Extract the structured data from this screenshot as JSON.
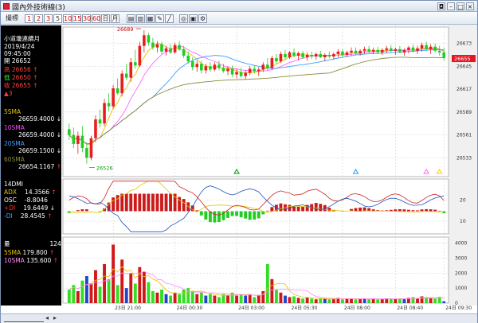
{
  "window": {
    "title": "國內外技術線(3)"
  },
  "toolbar": {
    "item_label": "撮標",
    "period_buttons": [
      "1",
      "2",
      "3",
      "5",
      "10",
      "15",
      "30",
      "60",
      "日",
      "月"
    ],
    "icon_names": [
      "layout-icon",
      "bar-style-icon",
      "grid-icon",
      "draw-icon",
      "line-icon",
      "find-icon",
      "chart-icon",
      "settings-icon"
    ]
  },
  "info": {
    "name": "小道瓊連續月",
    "date": "2019/4/24",
    "time": "09:45:00",
    "open_label": "開",
    "open_value": "26652",
    "high_label": "高",
    "high_value": "26656",
    "low_label": "低",
    "low_value": "26650",
    "close_label": "收",
    "close_value": "26655",
    "change": "▲3",
    "ma": [
      {
        "label": "5SMA",
        "value": "26659.4000",
        "arrow": "↓",
        "color": "#e6c300"
      },
      {
        "label": "10SMA",
        "value": "26659.4000",
        "arrow": "↓",
        "color": "#ff44ff"
      },
      {
        "label": "20SMA",
        "value": "26659.1500",
        "arrow": "↓",
        "color": "#3f9fff"
      },
      {
        "label": "60SMA",
        "value": "26654.1167",
        "arrow": "↑",
        "color": "#8a8a3a"
      }
    ],
    "dmi_title": "14DMI",
    "dmi": [
      {
        "label": "ADX",
        "value": "14.3566",
        "arrow": "↑",
        "color": "#e6c300"
      },
      {
        "label": "OSC",
        "value": "-8.8046",
        "arrow": "",
        "color": "#ffffff"
      },
      {
        "label": "+DI",
        "value": "19.6449",
        "arrow": "↓",
        "color": "#ff3030"
      },
      {
        "label": "-DI",
        "value": "28.4545",
        "arrow": "↑",
        "color": "#3f9fff"
      }
    ],
    "vol_title": "量",
    "vol_value": "124",
    "vol_ma": [
      {
        "label": "5SMA",
        "value": "179.800",
        "arrow": "↑",
        "color": "#e6c300"
      },
      {
        "label": "10SMA",
        "value": "135.600",
        "arrow": "↑",
        "color": "#ff88ff"
      }
    ]
  },
  "chart_data": {
    "type": "candlestick",
    "price_axis": {
      "ticks": [
        "26673",
        "26645",
        "26617",
        "26589",
        "26561",
        "26533"
      ],
      "range": [
        26510,
        26693
      ]
    },
    "last_price": "26655",
    "annotations": {
      "high": "26689",
      "low": "26526"
    },
    "dmi_axis": {
      "ticks": [
        "20",
        "10"
      ]
    },
    "volume_axis": {
      "ticks": [
        "4000",
        "3000",
        "2000",
        "1000",
        "0"
      ],
      "range": [
        0,
        4400
      ]
    },
    "time_labels": [
      "23日 21:00",
      "24日 00:30",
      "24日 03:00",
      "24日 05:30",
      "24日 08:00",
      "24日 08:40",
      "24日 09:30"
    ],
    "bars": [
      {
        "o": 26568,
        "h": 26575,
        "l": 26555,
        "c": 26561,
        "v": 900
      },
      {
        "o": 26561,
        "h": 26570,
        "l": 26545,
        "c": 26550,
        "v": 1200
      },
      {
        "o": 26550,
        "h": 26565,
        "l": 26538,
        "c": 26560,
        "v": 800
      },
      {
        "o": 26560,
        "h": 26572,
        "l": 26540,
        "c": 26545,
        "v": 1500
      },
      {
        "o": 26545,
        "h": 26552,
        "l": 26526,
        "c": 26533,
        "v": 1800
      },
      {
        "o": 26533,
        "h": 26560,
        "l": 26530,
        "c": 26557,
        "v": 1300
      },
      {
        "o": 26557,
        "h": 26585,
        "l": 26552,
        "c": 26580,
        "v": 2200
      },
      {
        "o": 26580,
        "h": 26592,
        "l": 26570,
        "c": 26575,
        "v": 1100
      },
      {
        "o": 26575,
        "h": 26605,
        "l": 26572,
        "c": 26600,
        "v": 2600
      },
      {
        "o": 26600,
        "h": 26612,
        "l": 26590,
        "c": 26596,
        "v": 1600
      },
      {
        "o": 26596,
        "h": 26622,
        "l": 26593,
        "c": 26618,
        "v": 3900
      },
      {
        "o": 26618,
        "h": 26630,
        "l": 26610,
        "c": 26612,
        "v": 1200
      },
      {
        "o": 26612,
        "h": 26640,
        "l": 26608,
        "c": 26636,
        "v": 2900
      },
      {
        "o": 26636,
        "h": 26648,
        "l": 26628,
        "c": 26631,
        "v": 1000
      },
      {
        "o": 26631,
        "h": 26655,
        "l": 26626,
        "c": 26650,
        "v": 2000
      },
      {
        "o": 26650,
        "h": 26665,
        "l": 26642,
        "c": 26646,
        "v": 1300
      },
      {
        "o": 26646,
        "h": 26675,
        "l": 26644,
        "c": 26670,
        "v": 2400
      },
      {
        "o": 26670,
        "h": 26689,
        "l": 26662,
        "c": 26683,
        "v": 2100
      },
      {
        "o": 26683,
        "h": 26686,
        "l": 26670,
        "c": 26674,
        "v": 1400
      },
      {
        "o": 26674,
        "h": 26680,
        "l": 26665,
        "c": 26668,
        "v": 800
      },
      {
        "o": 26668,
        "h": 26676,
        "l": 26662,
        "c": 26672,
        "v": 700
      },
      {
        "o": 26672,
        "h": 26675,
        "l": 26660,
        "c": 26663,
        "v": 900
      },
      {
        "o": 26663,
        "h": 26670,
        "l": 26658,
        "c": 26667,
        "v": 600
      },
      {
        "o": 26667,
        "h": 26672,
        "l": 26660,
        "c": 26662,
        "v": 500
      },
      {
        "o": 26662,
        "h": 26674,
        "l": 26660,
        "c": 26671,
        "v": 700
      },
      {
        "o": 26671,
        "h": 26676,
        "l": 26664,
        "c": 26666,
        "v": 600
      },
      {
        "o": 26666,
        "h": 26670,
        "l": 26655,
        "c": 26658,
        "v": 900
      },
      {
        "o": 26658,
        "h": 26663,
        "l": 26648,
        "c": 26651,
        "v": 1000
      },
      {
        "o": 26651,
        "h": 26656,
        "l": 26640,
        "c": 26644,
        "v": 800
      },
      {
        "o": 26644,
        "h": 26652,
        "l": 26638,
        "c": 26648,
        "v": 600
      },
      {
        "o": 26648,
        "h": 26652,
        "l": 26636,
        "c": 26640,
        "v": 700
      },
      {
        "o": 26640,
        "h": 26648,
        "l": 26636,
        "c": 26645,
        "v": 500
      },
      {
        "o": 26645,
        "h": 26650,
        "l": 26638,
        "c": 26641,
        "v": 600
      },
      {
        "o": 26641,
        "h": 26650,
        "l": 26639,
        "c": 26647,
        "v": 500
      },
      {
        "o": 26647,
        "h": 26652,
        "l": 26640,
        "c": 26643,
        "v": 400
      },
      {
        "o": 26643,
        "h": 26648,
        "l": 26637,
        "c": 26639,
        "v": 600
      },
      {
        "o": 26639,
        "h": 26645,
        "l": 26634,
        "c": 26642,
        "v": 500
      },
      {
        "o": 26642,
        "h": 26646,
        "l": 26632,
        "c": 26635,
        "v": 700
      },
      {
        "o": 26635,
        "h": 26642,
        "l": 26630,
        "c": 26638,
        "v": 500
      },
      {
        "o": 26638,
        "h": 26643,
        "l": 26631,
        "c": 26633,
        "v": 600
      },
      {
        "o": 26633,
        "h": 26640,
        "l": 26629,
        "c": 26637,
        "v": 500
      },
      {
        "o": 26637,
        "h": 26645,
        "l": 26634,
        "c": 26642,
        "v": 600
      },
      {
        "o": 26642,
        "h": 26646,
        "l": 26636,
        "c": 26639,
        "v": 400
      },
      {
        "o": 26639,
        "h": 26644,
        "l": 26633,
        "c": 26641,
        "v": 500
      },
      {
        "o": 26641,
        "h": 26650,
        "l": 26638,
        "c": 26647,
        "v": 800
      },
      {
        "o": 26647,
        "h": 26655,
        "l": 26640,
        "c": 26643,
        "v": 2600
      },
      {
        "o": 26643,
        "h": 26658,
        "l": 26641,
        "c": 26655,
        "v": 1600
      },
      {
        "o": 26655,
        "h": 26660,
        "l": 26648,
        "c": 26651,
        "v": 900
      },
      {
        "o": 26651,
        "h": 26663,
        "l": 26649,
        "c": 26660,
        "v": 700
      },
      {
        "o": 26660,
        "h": 26665,
        "l": 26653,
        "c": 26656,
        "v": 500
      },
      {
        "o": 26656,
        "h": 26664,
        "l": 26654,
        "c": 26662,
        "v": 400
      },
      {
        "o": 26662,
        "h": 26667,
        "l": 26656,
        "c": 26658,
        "v": 450
      },
      {
        "o": 26658,
        "h": 26663,
        "l": 26652,
        "c": 26661,
        "v": 350
      },
      {
        "o": 26661,
        "h": 26664,
        "l": 26654,
        "c": 26656,
        "v": 300
      },
      {
        "o": 26656,
        "h": 26662,
        "l": 26652,
        "c": 26659,
        "v": 380
      },
      {
        "o": 26659,
        "h": 26663,
        "l": 26654,
        "c": 26657,
        "v": 300
      },
      {
        "o": 26657,
        "h": 26662,
        "l": 26653,
        "c": 26660,
        "v": 250
      },
      {
        "o": 26660,
        "h": 26664,
        "l": 26655,
        "c": 26656,
        "v": 300
      },
      {
        "o": 26656,
        "h": 26661,
        "l": 26652,
        "c": 26659,
        "v": 280
      },
      {
        "o": 26659,
        "h": 26663,
        "l": 26655,
        "c": 26657,
        "v": 250
      },
      {
        "o": 26657,
        "h": 26662,
        "l": 26653,
        "c": 26660,
        "v": 300
      },
      {
        "o": 26660,
        "h": 26666,
        "l": 26656,
        "c": 26663,
        "v": 350
      },
      {
        "o": 26663,
        "h": 26666,
        "l": 26657,
        "c": 26659,
        "v": 250
      },
      {
        "o": 26659,
        "h": 26664,
        "l": 26656,
        "c": 26662,
        "v": 300
      },
      {
        "o": 26662,
        "h": 26668,
        "l": 26658,
        "c": 26664,
        "v": 320
      },
      {
        "o": 26664,
        "h": 26668,
        "l": 26659,
        "c": 26661,
        "v": 250
      },
      {
        "o": 26661,
        "h": 26666,
        "l": 26658,
        "c": 26664,
        "v": 280
      },
      {
        "o": 26664,
        "h": 26669,
        "l": 26660,
        "c": 26666,
        "v": 300
      },
      {
        "o": 26666,
        "h": 26670,
        "l": 26661,
        "c": 26663,
        "v": 260
      },
      {
        "o": 26663,
        "h": 26668,
        "l": 26660,
        "c": 26665,
        "v": 300
      },
      {
        "o": 26665,
        "h": 26669,
        "l": 26661,
        "c": 26662,
        "v": 250
      },
      {
        "o": 26662,
        "h": 26667,
        "l": 26659,
        "c": 26665,
        "v": 280
      },
      {
        "o": 26665,
        "h": 26670,
        "l": 26661,
        "c": 26667,
        "v": 320
      },
      {
        "o": 26667,
        "h": 26671,
        "l": 26662,
        "c": 26664,
        "v": 300
      },
      {
        "o": 26664,
        "h": 26668,
        "l": 26659,
        "c": 26666,
        "v": 280
      },
      {
        "o": 26666,
        "h": 26670,
        "l": 26661,
        "c": 26662,
        "v": 300
      },
      {
        "o": 26662,
        "h": 26667,
        "l": 26658,
        "c": 26665,
        "v": 260
      },
      {
        "o": 26665,
        "h": 26670,
        "l": 26661,
        "c": 26668,
        "v": 350
      },
      {
        "o": 26668,
        "h": 26672,
        "l": 26662,
        "c": 26664,
        "v": 400
      },
      {
        "o": 26664,
        "h": 26670,
        "l": 26660,
        "c": 26667,
        "v": 300
      },
      {
        "o": 26667,
        "h": 26674,
        "l": 26663,
        "c": 26671,
        "v": 450
      },
      {
        "o": 26671,
        "h": 26675,
        "l": 26664,
        "c": 26666,
        "v": 380
      },
      {
        "o": 26666,
        "h": 26672,
        "l": 26660,
        "c": 26669,
        "v": 330
      },
      {
        "o": 26669,
        "h": 26673,
        "l": 26662,
        "c": 26664,
        "v": 300
      },
      {
        "o": 26664,
        "h": 26670,
        "l": 26658,
        "c": 26662,
        "v": 420
      },
      {
        "o": 26662,
        "h": 26668,
        "l": 26652,
        "c": 26655,
        "v": 124
      }
    ],
    "ma_series": [
      {
        "name": "5SMA",
        "color": "#e6c300"
      },
      {
        "name": "10SMA",
        "color": "#ff66ff"
      },
      {
        "name": "20SMA",
        "color": "#3f9fff"
      },
      {
        "name": "60SMA",
        "color": "#8a8a3a"
      }
    ],
    "dmi_series": [
      {
        "name": "ADX",
        "color": "#e6c300"
      },
      {
        "name": "+DI",
        "color": "#cc2020"
      },
      {
        "name": "-DI",
        "color": "#2050c0"
      }
    ]
  },
  "status": {}
}
